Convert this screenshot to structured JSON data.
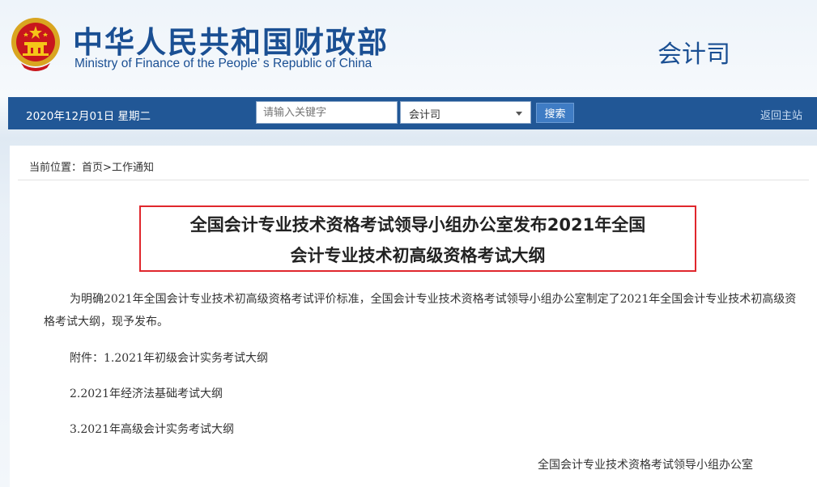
{
  "header": {
    "title_cn": "中华人民共和国财政部",
    "title_en": "Ministry of Finance of the People’ s Republic of China",
    "department": "会计司"
  },
  "navbar": {
    "date": "2020年12月01日  星期二",
    "search_placeholder": "请输入关键字",
    "select_value": "会计司",
    "search_button": "搜索",
    "back_home": "返回主站"
  },
  "breadcrumb": {
    "prefix": "当前位置：",
    "home": "首页",
    "separator": ">",
    "current": "工作通知"
  },
  "article": {
    "title_line1": "全国会计专业技术资格考试领导小组办公室发布2021年全国",
    "title_line2": "会计专业技术初高级资格考试大纲",
    "paragraph": "为明确2021年全国会计专业技术初高级资格考试评价标准，全国会计专业技术资格考试领导小组办公室制定了2021年全国会计专业技术初高级资格考试大纲，现予发布。",
    "attachment1": "附件：1.2021年初级会计实务考试大纲",
    "attachment2": "2.2021年经济法基础考试大纲",
    "attachment3": "3.2021年高级会计实务考试大纲",
    "signature": "全国会计专业技术资格考试领导小组办公室"
  },
  "colors": {
    "brand_blue": "#1a4f93",
    "nav_bg": "#215796",
    "highlight_red": "#e0272d"
  }
}
